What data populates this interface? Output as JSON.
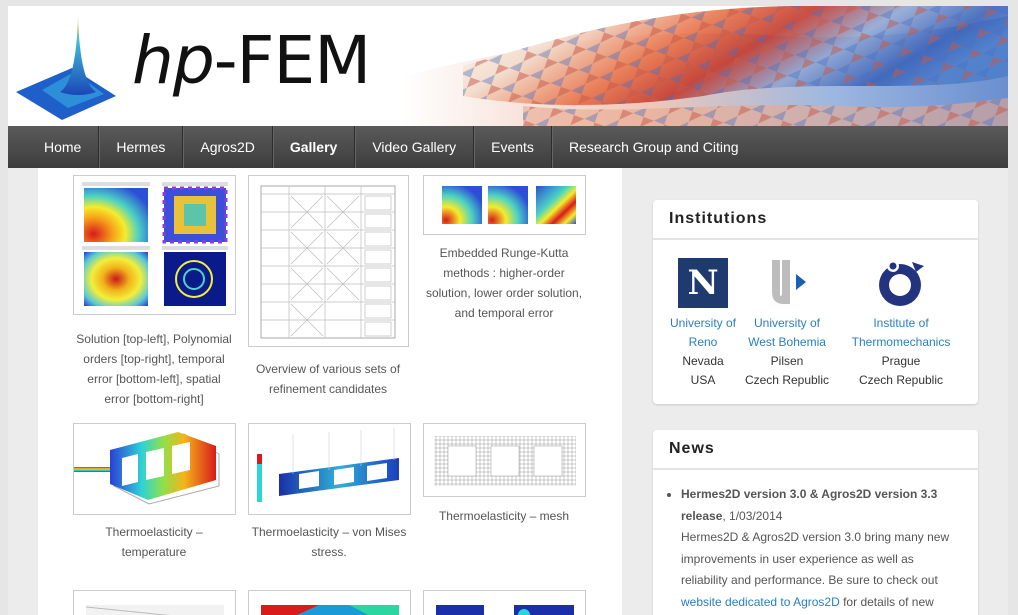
{
  "site": {
    "logo_italic": "hp",
    "logo_rest": "-FEM"
  },
  "nav": [
    "Home",
    "Hermes",
    "Agros2D",
    "Gallery",
    "Video Gallery",
    "Events",
    "Research Group and Citing"
  ],
  "active_nav": "Gallery",
  "gallery": [
    {
      "caption": [
        "Solution [top-left], Polynomial",
        "orders [top-right], temporal",
        "error [bottom-left], spatial",
        "error [bottom-right]"
      ]
    },
    {
      "caption": [
        "Overview of various sets of",
        "refinement candidates"
      ]
    },
    {
      "caption": [
        "Embedded Runge-Kutta",
        "methods : higher-order",
        "solution, lower order solution,",
        "and temporal error"
      ]
    },
    {
      "caption": [
        "Thermoelasticity –",
        "temperature"
      ]
    },
    {
      "caption": [
        "Thermoelasticity – von Mises",
        "stress."
      ]
    },
    {
      "caption": [
        "Thermoelasticity – mesh"
      ]
    }
  ],
  "institutions": {
    "title": "Institutions",
    "items": [
      {
        "name1": "University of",
        "name2": "Reno",
        "loc1": "Nevada",
        "loc2": "USA",
        "logo": "N"
      },
      {
        "name1": "University of",
        "name2": "West Bohemia",
        "loc1": "Pilsen",
        "loc2": "Czech Republic"
      },
      {
        "name1": "Institute of",
        "name2": "Thermomechanics",
        "loc1": "Prague",
        "loc2": "Czech Republic"
      }
    ]
  },
  "news": {
    "title": "News",
    "headline": "Hermes2D version 3.0 & Agros2D version 3.3 release",
    "date": ", 1/03/2014",
    "text1": "Hermes2D & Agros2D version 3.0 bring many new improvements in user experience as well as reliability and performance. Be sure to check out",
    "link": "website dedicated to Agros2D",
    "text2": " for details of new"
  },
  "colors": {
    "nav_bg": "#474747",
    "link": "#2a7fbf",
    "unr_blue": "#1f3a6e"
  }
}
